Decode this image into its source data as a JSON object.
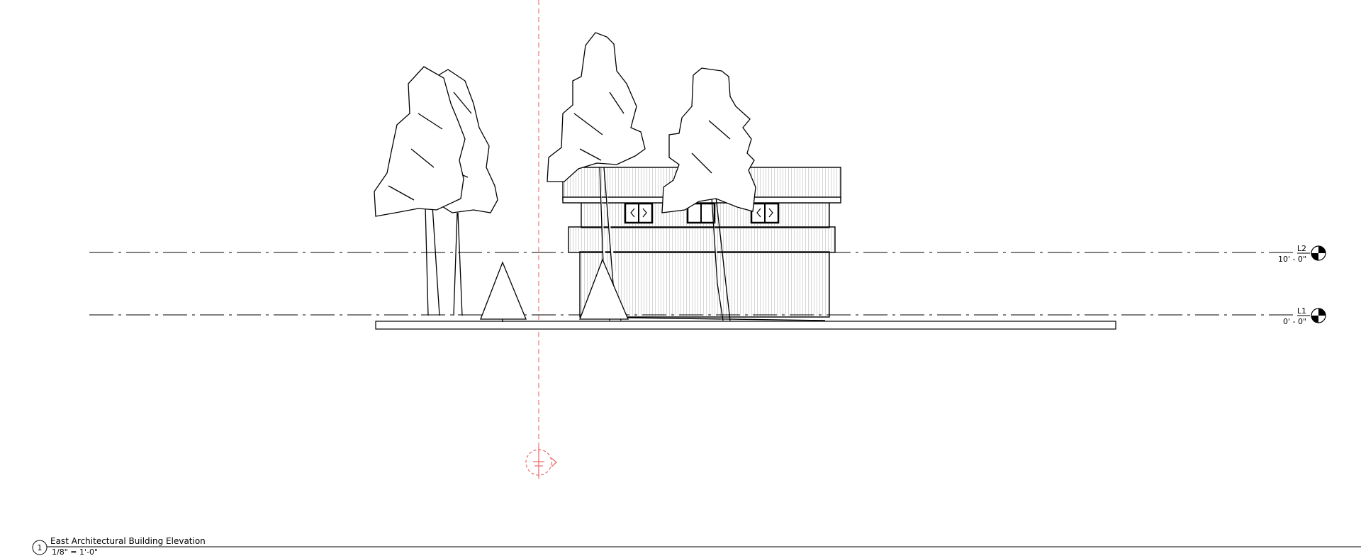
{
  "view": {
    "title": "East Architectural Building Elevation",
    "scale": "1/8\" = 1'-0\"",
    "number": "1"
  },
  "levels": [
    {
      "name": "L2",
      "elevation": "10' - 0\""
    },
    {
      "name": "L1",
      "elevation": "0' - 0\""
    }
  ],
  "colors": {
    "line": "#000000",
    "section_marker": "#ee5555"
  },
  "icons": {
    "level_head": "level-head-icon",
    "section_head": "section-head-icon"
  }
}
